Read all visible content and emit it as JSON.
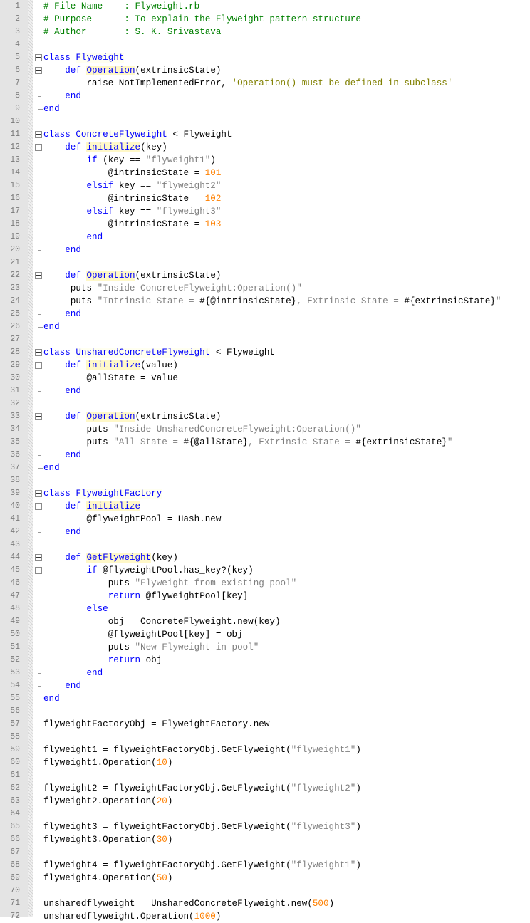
{
  "editor": {
    "language": "ruby",
    "colors": {
      "keyword": "#0000ff",
      "string": "#808080",
      "number": "#ff8000",
      "comment": "#008000",
      "gutter": "#e4e4e4",
      "line_number": "#7b7b7b"
    },
    "lines": [
      {
        "n": "1",
        "fold": "",
        "tokens": [
          [
            "cmt",
            "# File Name    : Flyweight.rb"
          ]
        ]
      },
      {
        "n": "2",
        "fold": "",
        "tokens": [
          [
            "cmt",
            "# Purpose      : To explain the Flyweight pattern structure"
          ]
        ]
      },
      {
        "n": "3",
        "fold": "",
        "tokens": [
          [
            "cmt",
            "# Author       : S. K. Srivastava"
          ]
        ]
      },
      {
        "n": "4",
        "fold": "",
        "tokens": []
      },
      {
        "n": "5",
        "fold": "open",
        "tokens": [
          [
            "kw",
            "class"
          ],
          [
            "plain",
            " "
          ],
          [
            "cls",
            "Flyweight"
          ]
        ]
      },
      {
        "n": "6",
        "fold": "open-inner",
        "tokens": [
          [
            "plain",
            "    "
          ],
          [
            "kw",
            "def"
          ],
          [
            "plain",
            " "
          ],
          [
            "fn",
            "Operation"
          ],
          [
            "plain",
            "(extrinsicState)"
          ]
        ]
      },
      {
        "n": "7",
        "fold": "line",
        "tokens": [
          [
            "plain",
            "        raise NotImplementedError, "
          ],
          [
            "str2",
            "'Operation() must be defined in subclass'"
          ]
        ]
      },
      {
        "n": "8",
        "fold": "end-inner",
        "tokens": [
          [
            "plain",
            "    "
          ],
          [
            "kw",
            "end"
          ]
        ]
      },
      {
        "n": "9",
        "fold": "end",
        "tokens": [
          [
            "kw",
            "end"
          ]
        ]
      },
      {
        "n": "10",
        "fold": "",
        "tokens": []
      },
      {
        "n": "11",
        "fold": "open",
        "tokens": [
          [
            "kw",
            "class"
          ],
          [
            "plain",
            " "
          ],
          [
            "cls",
            "ConcreteFlyweight"
          ],
          [
            "plain",
            " < Flyweight"
          ]
        ]
      },
      {
        "n": "12",
        "fold": "open-inner",
        "tokens": [
          [
            "plain",
            "    "
          ],
          [
            "kw",
            "def"
          ],
          [
            "plain",
            " "
          ],
          [
            "fn",
            "initialize"
          ],
          [
            "plain",
            "(key)"
          ]
        ]
      },
      {
        "n": "13",
        "fold": "line",
        "tokens": [
          [
            "plain",
            "        "
          ],
          [
            "kw",
            "if"
          ],
          [
            "plain",
            " (key == "
          ],
          [
            "str",
            "\"flyweight1\""
          ],
          [
            "plain",
            ")"
          ]
        ]
      },
      {
        "n": "14",
        "fold": "line",
        "tokens": [
          [
            "plain",
            "            @intrinsicState = "
          ],
          [
            "num",
            "101"
          ]
        ]
      },
      {
        "n": "15",
        "fold": "line",
        "tokens": [
          [
            "plain",
            "        "
          ],
          [
            "kw",
            "elsif"
          ],
          [
            "plain",
            " key == "
          ],
          [
            "str",
            "\"flyweight2\""
          ]
        ]
      },
      {
        "n": "16",
        "fold": "line",
        "tokens": [
          [
            "plain",
            "            @intrinsicState = "
          ],
          [
            "num",
            "102"
          ]
        ]
      },
      {
        "n": "17",
        "fold": "line",
        "tokens": [
          [
            "plain",
            "        "
          ],
          [
            "kw",
            "elsif"
          ],
          [
            "plain",
            " key == "
          ],
          [
            "str",
            "\"flyweight3\""
          ]
        ]
      },
      {
        "n": "18",
        "fold": "line",
        "tokens": [
          [
            "plain",
            "            @intrinsicState = "
          ],
          [
            "num",
            "103"
          ]
        ]
      },
      {
        "n": "19",
        "fold": "line",
        "tokens": [
          [
            "plain",
            "        "
          ],
          [
            "kw",
            "end"
          ]
        ]
      },
      {
        "n": "20",
        "fold": "end-inner",
        "tokens": [
          [
            "plain",
            "    "
          ],
          [
            "kw",
            "end"
          ]
        ]
      },
      {
        "n": "21",
        "fold": "line",
        "tokens": []
      },
      {
        "n": "22",
        "fold": "open-inner",
        "tokens": [
          [
            "plain",
            "    "
          ],
          [
            "kw",
            "def"
          ],
          [
            "plain",
            " "
          ],
          [
            "fn",
            "Operation"
          ],
          [
            "plain",
            "(extrinsicState)"
          ]
        ]
      },
      {
        "n": "23",
        "fold": "line",
        "tokens": [
          [
            "plain",
            "     puts "
          ],
          [
            "str",
            "\"Inside ConcreteFlyweight:Operation()\""
          ]
        ]
      },
      {
        "n": "24",
        "fold": "line",
        "tokens": [
          [
            "plain",
            "     puts "
          ],
          [
            "str",
            "\"Intrinsic State = "
          ],
          [
            "plain",
            "#{@intrinsicState}"
          ],
          [
            "str",
            ", Extrinsic State = "
          ],
          [
            "plain",
            "#{extrinsicState}"
          ],
          [
            "str",
            "\""
          ]
        ]
      },
      {
        "n": "25",
        "fold": "end-inner",
        "tokens": [
          [
            "plain",
            "    "
          ],
          [
            "kw",
            "end"
          ]
        ]
      },
      {
        "n": "26",
        "fold": "end",
        "tokens": [
          [
            "kw",
            "end"
          ]
        ]
      },
      {
        "n": "27",
        "fold": "",
        "tokens": []
      },
      {
        "n": "28",
        "fold": "open",
        "tokens": [
          [
            "kw",
            "class"
          ],
          [
            "plain",
            " "
          ],
          [
            "cls",
            "UnsharedConcreteFlyweight"
          ],
          [
            "plain",
            " < Flyweight"
          ]
        ]
      },
      {
        "n": "29",
        "fold": "open-inner",
        "tokens": [
          [
            "plain",
            "    "
          ],
          [
            "kw",
            "def"
          ],
          [
            "plain",
            " "
          ],
          [
            "fn",
            "initialize"
          ],
          [
            "plain",
            "(value)"
          ]
        ]
      },
      {
        "n": "30",
        "fold": "line",
        "tokens": [
          [
            "plain",
            "        @allState = value"
          ]
        ]
      },
      {
        "n": "31",
        "fold": "end-inner",
        "tokens": [
          [
            "plain",
            "    "
          ],
          [
            "kw",
            "end"
          ]
        ]
      },
      {
        "n": "32",
        "fold": "line",
        "tokens": []
      },
      {
        "n": "33",
        "fold": "open-inner",
        "tokens": [
          [
            "plain",
            "    "
          ],
          [
            "kw",
            "def"
          ],
          [
            "plain",
            " "
          ],
          [
            "fn",
            "Operation"
          ],
          [
            "plain",
            "(extrinsicState)"
          ]
        ]
      },
      {
        "n": "34",
        "fold": "line",
        "tokens": [
          [
            "plain",
            "        puts "
          ],
          [
            "str",
            "\"Inside UnsharedConcreteFlyweight:Operation()\""
          ]
        ]
      },
      {
        "n": "35",
        "fold": "line",
        "tokens": [
          [
            "plain",
            "        puts "
          ],
          [
            "str",
            "\"All State = "
          ],
          [
            "plain",
            "#{@allState}"
          ],
          [
            "str",
            ", Extrinsic State = "
          ],
          [
            "plain",
            "#{extrinsicState}"
          ],
          [
            "str",
            "\""
          ]
        ]
      },
      {
        "n": "36",
        "fold": "end-inner",
        "tokens": [
          [
            "plain",
            "    "
          ],
          [
            "kw",
            "end"
          ]
        ]
      },
      {
        "n": "37",
        "fold": "end",
        "tokens": [
          [
            "kw",
            "end"
          ]
        ]
      },
      {
        "n": "38",
        "fold": "",
        "tokens": []
      },
      {
        "n": "39",
        "fold": "open",
        "tokens": [
          [
            "kw",
            "class"
          ],
          [
            "plain",
            " "
          ],
          [
            "cls",
            "FlyweightFactory"
          ]
        ]
      },
      {
        "n": "40",
        "fold": "open-inner",
        "tokens": [
          [
            "plain",
            "    "
          ],
          [
            "kw",
            "def"
          ],
          [
            "plain",
            " "
          ],
          [
            "fn",
            "initialize"
          ]
        ]
      },
      {
        "n": "41",
        "fold": "line",
        "tokens": [
          [
            "plain",
            "        @flyweightPool = Hash.new"
          ]
        ]
      },
      {
        "n": "42",
        "fold": "end-inner",
        "tokens": [
          [
            "plain",
            "    "
          ],
          [
            "kw",
            "end"
          ]
        ]
      },
      {
        "n": "43",
        "fold": "line",
        "tokens": []
      },
      {
        "n": "44",
        "fold": "open-inner",
        "tokens": [
          [
            "plain",
            "    "
          ],
          [
            "kw",
            "def"
          ],
          [
            "plain",
            " "
          ],
          [
            "fn",
            "GetFlyweight"
          ],
          [
            "plain",
            "(key)"
          ]
        ]
      },
      {
        "n": "45",
        "fold": "open-inner",
        "tokens": [
          [
            "plain",
            "        "
          ],
          [
            "kw",
            "if"
          ],
          [
            "plain",
            " @flyweightPool.has_key?(key)"
          ]
        ]
      },
      {
        "n": "46",
        "fold": "line",
        "tokens": [
          [
            "plain",
            "            puts "
          ],
          [
            "str",
            "\"Flyweight from existing pool\""
          ]
        ]
      },
      {
        "n": "47",
        "fold": "line",
        "tokens": [
          [
            "plain",
            "            "
          ],
          [
            "kw",
            "return"
          ],
          [
            "plain",
            " @flyweightPool[key]"
          ]
        ]
      },
      {
        "n": "48",
        "fold": "line",
        "tokens": [
          [
            "plain",
            "        "
          ],
          [
            "kw",
            "else"
          ]
        ]
      },
      {
        "n": "49",
        "fold": "line",
        "tokens": [
          [
            "plain",
            "            obj = ConcreteFlyweight.new(key)"
          ]
        ]
      },
      {
        "n": "50",
        "fold": "line",
        "tokens": [
          [
            "plain",
            "            @flyweightPool[key] = obj"
          ]
        ]
      },
      {
        "n": "51",
        "fold": "line",
        "tokens": [
          [
            "plain",
            "            puts "
          ],
          [
            "str",
            "\"New Flyweight in pool\""
          ]
        ]
      },
      {
        "n": "52",
        "fold": "line",
        "tokens": [
          [
            "plain",
            "            "
          ],
          [
            "kw",
            "return"
          ],
          [
            "plain",
            " obj"
          ]
        ]
      },
      {
        "n": "53",
        "fold": "end-inner",
        "tokens": [
          [
            "plain",
            "        "
          ],
          [
            "kw",
            "end"
          ]
        ]
      },
      {
        "n": "54",
        "fold": "end-inner",
        "tokens": [
          [
            "plain",
            "    "
          ],
          [
            "kw",
            "end"
          ]
        ]
      },
      {
        "n": "55",
        "fold": "end",
        "tokens": [
          [
            "kw",
            "end"
          ]
        ]
      },
      {
        "n": "56",
        "fold": "",
        "tokens": []
      },
      {
        "n": "57",
        "fold": "",
        "tokens": [
          [
            "plain",
            "flyweightFactoryObj = FlyweightFactory.new"
          ]
        ]
      },
      {
        "n": "58",
        "fold": "",
        "tokens": []
      },
      {
        "n": "59",
        "fold": "",
        "tokens": [
          [
            "plain",
            "flyweight1 = flyweightFactoryObj.GetFlyweight("
          ],
          [
            "str",
            "\"flyweight1\""
          ],
          [
            "plain",
            ")"
          ]
        ]
      },
      {
        "n": "60",
        "fold": "",
        "tokens": [
          [
            "plain",
            "flyweight1.Operation("
          ],
          [
            "num",
            "10"
          ],
          [
            "plain",
            ")"
          ]
        ]
      },
      {
        "n": "61",
        "fold": "",
        "tokens": []
      },
      {
        "n": "62",
        "fold": "",
        "tokens": [
          [
            "plain",
            "flyweight2 = flyweightFactoryObj.GetFlyweight("
          ],
          [
            "str",
            "\"flyweight2\""
          ],
          [
            "plain",
            ")"
          ]
        ]
      },
      {
        "n": "63",
        "fold": "",
        "tokens": [
          [
            "plain",
            "flyweight2.Operation("
          ],
          [
            "num",
            "20"
          ],
          [
            "plain",
            ")"
          ]
        ]
      },
      {
        "n": "64",
        "fold": "",
        "tokens": []
      },
      {
        "n": "65",
        "fold": "",
        "tokens": [
          [
            "plain",
            "flyweight3 = flyweightFactoryObj.GetFlyweight("
          ],
          [
            "str",
            "\"flyweight3\""
          ],
          [
            "plain",
            ")"
          ]
        ]
      },
      {
        "n": "66",
        "fold": "",
        "tokens": [
          [
            "plain",
            "flyweight3.Operation("
          ],
          [
            "num",
            "30"
          ],
          [
            "plain",
            ")"
          ]
        ]
      },
      {
        "n": "67",
        "fold": "",
        "tokens": []
      },
      {
        "n": "68",
        "fold": "",
        "tokens": [
          [
            "plain",
            "flyweight4 = flyweightFactoryObj.GetFlyweight("
          ],
          [
            "str",
            "\"flyweight1\""
          ],
          [
            "plain",
            ")"
          ]
        ]
      },
      {
        "n": "69",
        "fold": "",
        "tokens": [
          [
            "plain",
            "flyweight4.Operation("
          ],
          [
            "num",
            "50"
          ],
          [
            "plain",
            ")"
          ]
        ]
      },
      {
        "n": "70",
        "fold": "",
        "tokens": []
      },
      {
        "n": "71",
        "fold": "",
        "tokens": [
          [
            "plain",
            "unsharedflyweight = UnsharedConcreteFlyweight.new("
          ],
          [
            "num",
            "500"
          ],
          [
            "plain",
            ")"
          ]
        ]
      },
      {
        "n": "72",
        "fold": "",
        "tokens": [
          [
            "plain",
            "unsharedflyweight.Operation("
          ],
          [
            "num",
            "1000"
          ],
          [
            "plain",
            ")"
          ]
        ]
      }
    ]
  }
}
